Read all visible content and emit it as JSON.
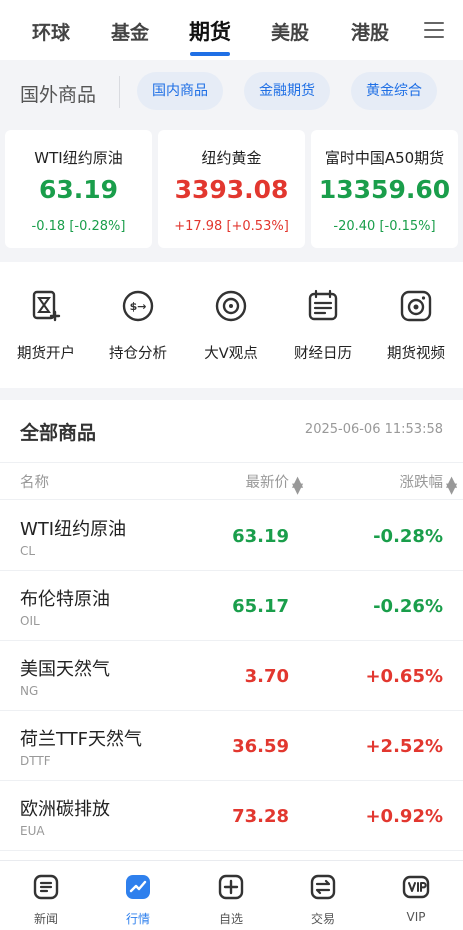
{
  "top_tabs": [
    {
      "label": "环球"
    },
    {
      "label": "基金"
    },
    {
      "label": "期货"
    },
    {
      "label": "美股"
    },
    {
      "label": "港股"
    }
  ],
  "active_tab": "期货",
  "sub_nav": {
    "title": "国外商品",
    "pills": [
      "国内商品",
      "金融期货",
      "黄金综合"
    ]
  },
  "quote_cards": [
    {
      "name": "WTI纽约原油",
      "price": "63.19",
      "change": "-0.18 [-0.28%]",
      "trend": "down"
    },
    {
      "name": "纽约黄金",
      "price": "3393.08",
      "change": "+17.98 [+0.53%]",
      "trend": "up"
    },
    {
      "name": "富时中国A50期货",
      "price": "13359.60",
      "change": "-20.40 [-0.15%]",
      "trend": "down"
    }
  ],
  "shortcuts": [
    {
      "label": "期货开户",
      "icon": "hourglass-plus-icon"
    },
    {
      "label": "持仓分析",
      "icon": "exchange-circle-icon"
    },
    {
      "label": "大V观点",
      "icon": "target-icon"
    },
    {
      "label": "财经日历",
      "icon": "calendar-icon"
    },
    {
      "label": "期货视频",
      "icon": "camera-icon"
    }
  ],
  "list": {
    "title": "全部商品",
    "timestamp": "2025-06-06 11:53:58",
    "columns": {
      "name": "名称",
      "price": "最新价",
      "change": "涨跌幅"
    },
    "rows": [
      {
        "name": "WTI纽约原油",
        "code": "CL",
        "price": "63.19",
        "change": "-0.28%",
        "trend": "down"
      },
      {
        "name": "布伦特原油",
        "code": "OIL",
        "price": "65.17",
        "change": "-0.26%",
        "trend": "down"
      },
      {
        "name": "美国天然气",
        "code": "NG",
        "price": "3.70",
        "change": "+0.65%",
        "trend": "up"
      },
      {
        "name": "荷兰TTF天然气",
        "code": "DTTF",
        "price": "36.59",
        "change": "+2.52%",
        "trend": "up"
      },
      {
        "name": "欧洲碳排放",
        "code": "EUA",
        "price": "73.28",
        "change": "+0.92%",
        "trend": "up"
      }
    ]
  },
  "bottom_nav": [
    {
      "label": "新闻",
      "icon": "news-icon"
    },
    {
      "label": "行情",
      "icon": "chart-icon"
    },
    {
      "label": "自选",
      "icon": "add-square-icon"
    },
    {
      "label": "交易",
      "icon": "exchange-icon"
    },
    {
      "label": "VIP",
      "icon": "vip-icon"
    }
  ],
  "active_bottom": "行情",
  "colors": {
    "up": "#e2372f",
    "down": "#1a9e4b",
    "accent": "#1f6fe5"
  }
}
